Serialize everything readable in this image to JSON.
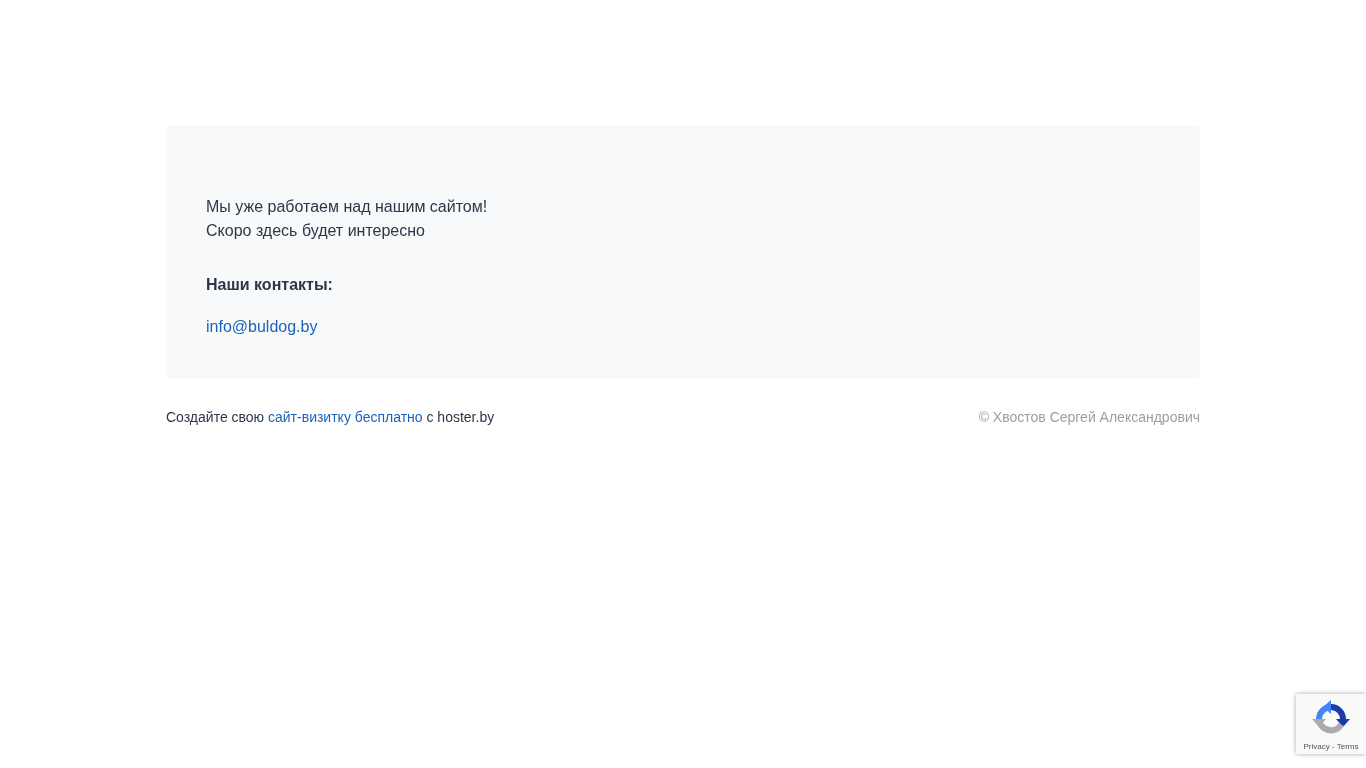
{
  "message": {
    "lines": [
      "Мы уже работаем над нашим сайтом!",
      "Скоро здесь будет интересно"
    ]
  },
  "contacts": {
    "heading": "Наши контакты:",
    "email": "info@buldog.by"
  },
  "footer": {
    "before": "Создайте свою ",
    "link": "сайт-визитку бесплатно",
    "after": " с hoster.by",
    "copyright": "© Хвостов Сергей Александрович"
  },
  "recaptcha": {
    "privacy": "Privacy",
    "separator": " - ",
    "terms": "Terms"
  }
}
